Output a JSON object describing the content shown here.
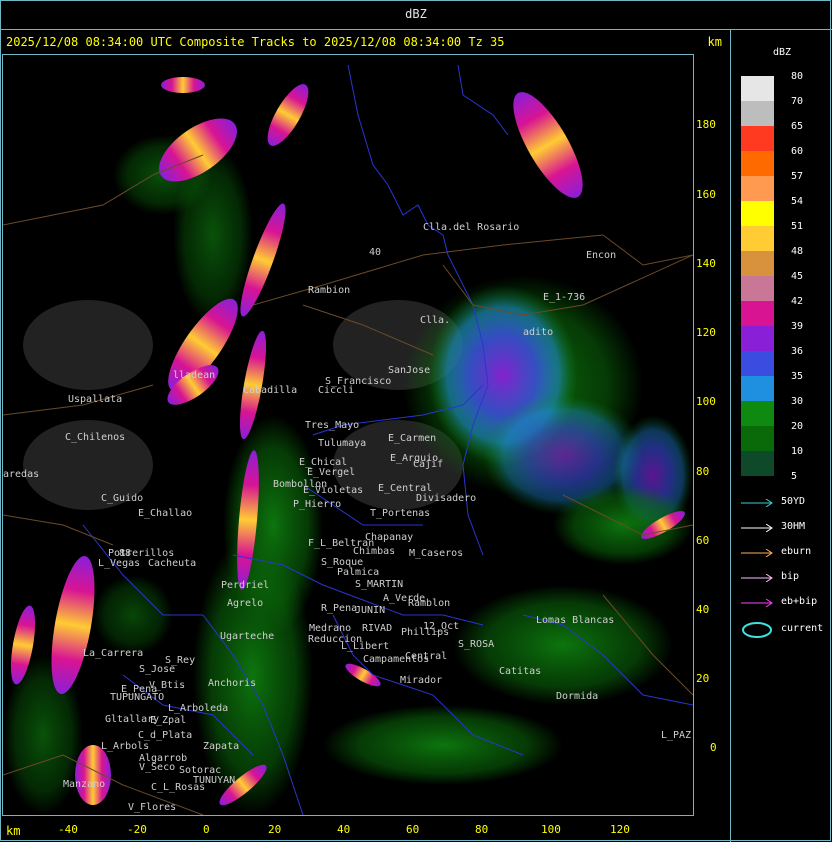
{
  "top_title": "dBZ",
  "header": {
    "text": "2025/12/08 08:34:00 UTC Composite Tracks to 2025/12/08 08:34:00 Tz 35",
    "km_label": "km"
  },
  "axes": {
    "x_unit": "km",
    "x_ticks": [
      "-40",
      "-20",
      "0",
      "20",
      "40",
      "60",
      "80",
      "100",
      "120"
    ],
    "y_ticks": [
      "180",
      "160",
      "140",
      "120",
      "100",
      "80",
      "60",
      "40",
      "20",
      "0"
    ]
  },
  "legend": {
    "title": "dBZ",
    "levels": [
      {
        "value": "80",
        "color": "#e6e6e6"
      },
      {
        "value": "70",
        "color": "#bdbdbd"
      },
      {
        "value": "65",
        "color": "#ff3a20"
      },
      {
        "value": "60",
        "color": "#ff6a00"
      },
      {
        "value": "57",
        "color": "#ff9a50"
      },
      {
        "value": "54",
        "color": "#ffff00"
      },
      {
        "value": "51",
        "color": "#ffcc33"
      },
      {
        "value": "48",
        "color": "#d8913c"
      },
      {
        "value": "45",
        "color": "#c87896"
      },
      {
        "value": "42",
        "color": "#d81493"
      },
      {
        "value": "39",
        "color": "#8a1fd8"
      },
      {
        "value": "36",
        "color": "#3b4de0"
      },
      {
        "value": "35",
        "color": "#1f8fe0"
      },
      {
        "value": "30",
        "color": "#0f8a10"
      },
      {
        "value": "20",
        "color": "#0a6a0a"
      },
      {
        "value": "10",
        "color": "#0e4a2a"
      },
      {
        "value": "5",
        "color": "#4a3a8a"
      }
    ]
  },
  "tracks": [
    {
      "label": "50YD",
      "color": "#3fd0d0",
      "kind": "arrow"
    },
    {
      "label": "30HM",
      "color": "#ffffff",
      "kind": "arrow"
    },
    {
      "label": "eburn",
      "color": "#ffb060",
      "kind": "arrow"
    },
    {
      "label": "bip",
      "color": "#ffc0ff",
      "kind": "arrow"
    },
    {
      "label": "eb+bip",
      "color": "#ff40ff",
      "kind": "arrow"
    },
    {
      "label": "current",
      "color": "#3fe0e0",
      "kind": "ellipse"
    }
  ],
  "places": [
    {
      "name": "Clla.del Rosario"
    },
    {
      "name": "Encon"
    },
    {
      "name": "Rambion"
    },
    {
      "name": "E_1-736"
    },
    {
      "name": "Clla."
    },
    {
      "name": "adito"
    },
    {
      "name": "S_Francisco"
    },
    {
      "name": "SanJose"
    },
    {
      "name": "Uspallata"
    },
    {
      "name": "lladean"
    },
    {
      "name": "Cabadilla"
    },
    {
      "name": "Ciccli"
    },
    {
      "name": "Tres_Mayo"
    },
    {
      "name": "Tulumaya"
    },
    {
      "name": "E_Carmen"
    },
    {
      "name": "C_Chilenos"
    },
    {
      "name": "E_Chical"
    },
    {
      "name": "E_Vergel"
    },
    {
      "name": "E_Arguio"
    },
    {
      "name": "Cajif"
    },
    {
      "name": "aredas"
    },
    {
      "name": "Bombollon"
    },
    {
      "name": "E_Violetas"
    },
    {
      "name": "E_Central"
    },
    {
      "name": "Divisadero"
    },
    {
      "name": "C_Guido"
    },
    {
      "name": "P_Hierro"
    },
    {
      "name": "E_Challao"
    },
    {
      "name": "T_Portenas"
    },
    {
      "name": "Chapanay"
    },
    {
      "name": "F_L_Beltran"
    },
    {
      "name": "Chimbas"
    },
    {
      "name": "M_Caseros"
    },
    {
      "name": "Potrerillos"
    },
    {
      "name": "L_Vegas"
    },
    {
      "name": "Cacheuta"
    },
    {
      "name": "S_Roque"
    },
    {
      "name": "Palmica"
    },
    {
      "name": "S_MARTIN"
    },
    {
      "name": "Perdriel"
    },
    {
      "name": "A_Verde"
    },
    {
      "name": "Agrelo"
    },
    {
      "name": "R_Pena"
    },
    {
      "name": "JUNIN"
    },
    {
      "name": "Ramblon"
    },
    {
      "name": "Ugarteche"
    },
    {
      "name": "Medrano"
    },
    {
      "name": "RIVAD"
    },
    {
      "name": "Phillips"
    },
    {
      "name": "Lomas Blancas"
    },
    {
      "name": "Reduccion"
    },
    {
      "name": "12_Oct"
    },
    {
      "name": "La_Carrera"
    },
    {
      "name": "S_Rey"
    },
    {
      "name": "S_Jose"
    },
    {
      "name": "L_Libert"
    },
    {
      "name": "S_ROSA"
    },
    {
      "name": "Campamentos"
    },
    {
      "name": "Central"
    },
    {
      "name": "Catitas"
    },
    {
      "name": "E_Pena"
    },
    {
      "name": "V_Btis"
    },
    {
      "name": "Anchoris"
    },
    {
      "name": "TUPUNGATO"
    },
    {
      "name": "Mirador"
    },
    {
      "name": "Dormida"
    },
    {
      "name": "L_Arboleda"
    },
    {
      "name": "Gltallary"
    },
    {
      "name": "E_Zpal"
    },
    {
      "name": "C_d_Plata"
    },
    {
      "name": "L_Arbols"
    },
    {
      "name": "Zapata"
    },
    {
      "name": "L_PAZ"
    },
    {
      "name": "Algarrob"
    },
    {
      "name": "V_Seco"
    },
    {
      "name": "Sotorac"
    },
    {
      "name": "TUNUYAN"
    },
    {
      "name": "C_L_Rosas"
    },
    {
      "name": "Manzano"
    },
    {
      "name": "V_Flores"
    },
    {
      "name": "88"
    },
    {
      "name": "40"
    }
  ]
}
